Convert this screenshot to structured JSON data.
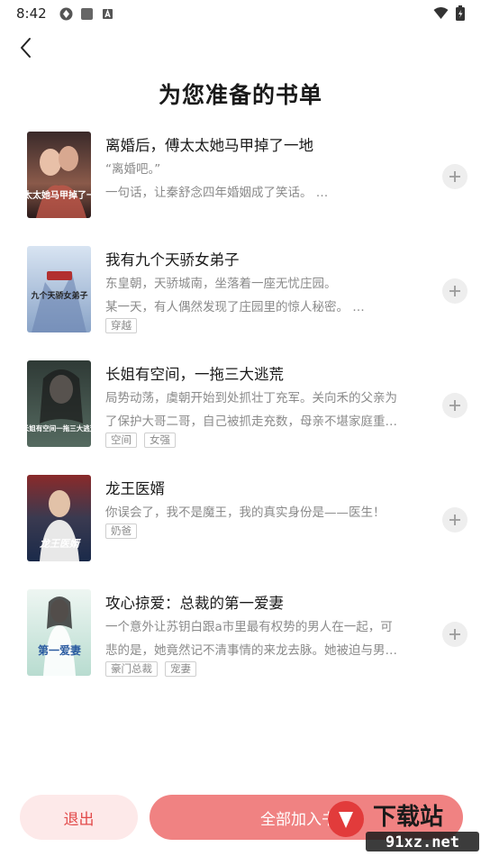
{
  "status_bar": {
    "time": "8:42"
  },
  "page": {
    "title": "为您准备的书单"
  },
  "books": [
    {
      "title": "离婚后，傅太太她马甲掉了一地",
      "desc": [
        "“离婚吧。”",
        "一句话，让秦舒念四年婚姻成了笑话。 …"
      ],
      "tags": [],
      "cover_text": "傅太太她马甲掉了一地"
    },
    {
      "title": "我有九个天骄女弟子",
      "desc": [
        "东皇朝，天骄城南，坐落着一座无忧庄园。",
        "某一天，有人偶然发现了庄园里的惊人秘密。 …"
      ],
      "tags": [
        "穿越"
      ],
      "cover_text": "九个天骄女弟子"
    },
    {
      "title": "长姐有空间，一拖三大逃荒",
      "desc": [
        "局势动荡，虞朝开始到处抓壮丁充军。关向禾的父亲为",
        "了保护大哥二哥，自己被抓走充数，母亲不堪家庭重…"
      ],
      "tags": [
        "空间",
        "女强"
      ],
      "cover_text": "长姐有空间一拖三大逃荒"
    },
    {
      "title": "龙王医婿",
      "desc": [
        "你误会了，我不是魔王，我的真实身份是——医生！"
      ],
      "tags": [
        "奶爸"
      ],
      "cover_text": "龙王医婿"
    },
    {
      "title": "攻心掠爱：总裁的第一爱妻",
      "desc": [
        "一个意外让苏钥白跟a市里最有权势的男人在一起，可",
        "悲的是，她竟然记不清事情的来龙去脉。她被迫与男…"
      ],
      "tags": [
        "豪门总裁",
        "宠妻"
      ],
      "cover_text": "第一爱妻"
    }
  ],
  "footer": {
    "exit_label": "退出",
    "add_all_label": "全部加入书架"
  },
  "watermark": {
    "text": "下载站",
    "url": "91xz.net"
  },
  "colors": {
    "accent": "#f08282",
    "exit_bg": "#fde9e9",
    "exit_text": "#e24a4a"
  }
}
